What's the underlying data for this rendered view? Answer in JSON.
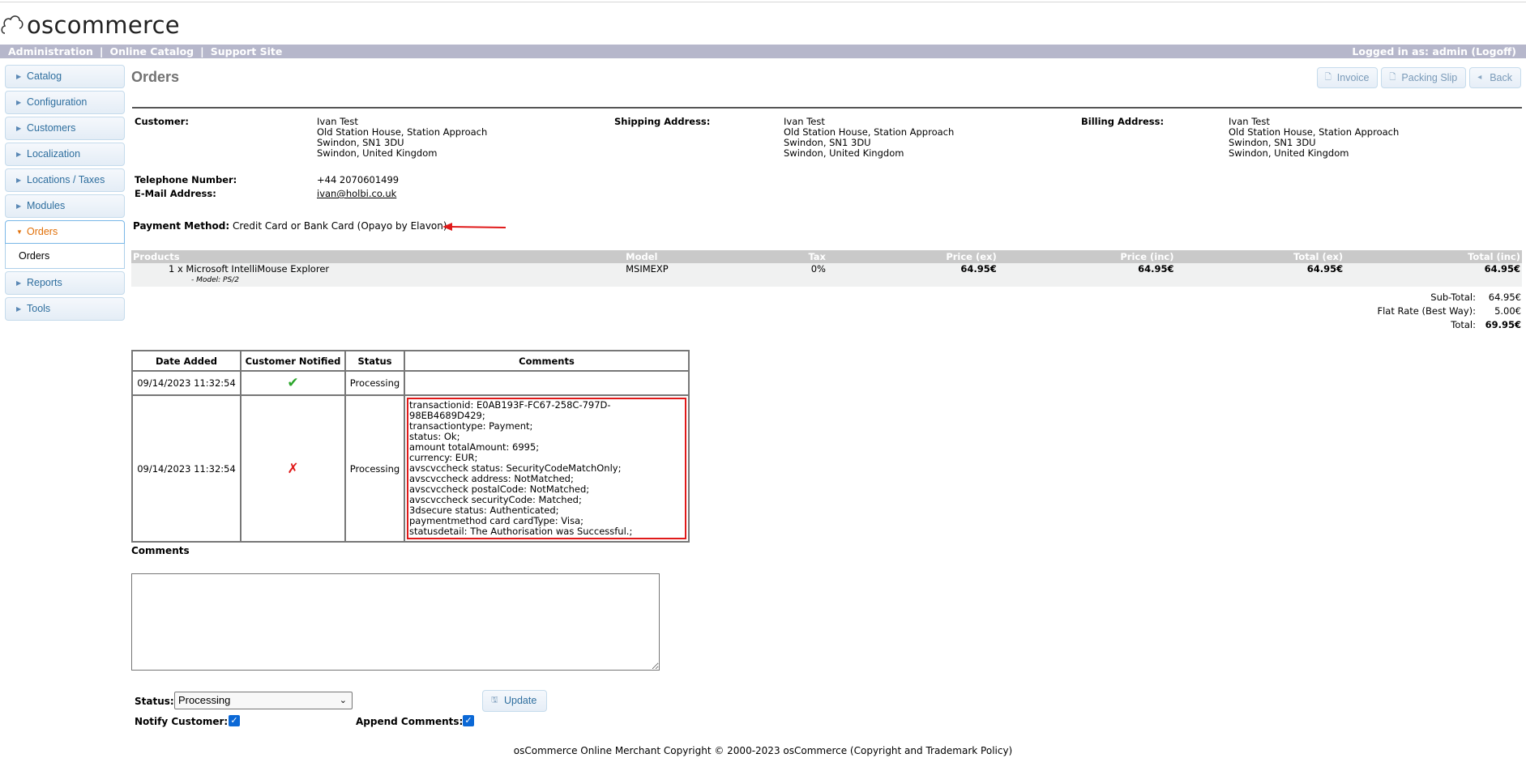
{
  "logo": {
    "text": "oscommerce"
  },
  "navbar": {
    "links": [
      "Administration",
      "Online Catalog",
      "Support Site"
    ],
    "logged_in": "Logged in as: admin (Logoff)"
  },
  "sidebar": {
    "items": [
      {
        "label": "Catalog"
      },
      {
        "label": "Configuration"
      },
      {
        "label": "Customers"
      },
      {
        "label": "Localization"
      },
      {
        "label": "Locations / Taxes"
      },
      {
        "label": "Modules"
      },
      {
        "label": "Orders",
        "active": true
      },
      {
        "label": "Reports"
      },
      {
        "label": "Tools"
      }
    ],
    "submenu": [
      "Orders"
    ]
  },
  "page": {
    "title": "Orders",
    "buttons": {
      "invoice": "Invoice",
      "packing_slip": "Packing Slip",
      "back": "Back"
    }
  },
  "customer": {
    "label": "Customer:",
    "lines": [
      "Ivan Test",
      "Old Station House, Station Approach",
      "Swindon, SN1 3DU",
      "Swindon, United Kingdom"
    ],
    "phone_label": "Telephone Number:",
    "phone": "+44 2070601499",
    "email_label": "E-Mail Address:",
    "email": "ivan@holbi.co.uk"
  },
  "shipping": {
    "label": "Shipping Address:",
    "lines": [
      "Ivan Test",
      "Old Station House, Station Approach",
      "Swindon, SN1 3DU",
      "Swindon, United Kingdom"
    ]
  },
  "billing": {
    "label": "Billing Address:",
    "lines": [
      "Ivan Test",
      "Old Station House, Station Approach",
      "Swindon, SN1 3DU",
      "Swindon, United Kingdom"
    ]
  },
  "payment": {
    "label": "Payment Method:",
    "value": "Credit Card or Bank Card (Opayo by Elavon)"
  },
  "products": {
    "headers": [
      "Products",
      "Model",
      "Tax",
      "Price (ex)",
      "Price (inc)",
      "Total (ex)",
      "Total (inc)"
    ],
    "rows": [
      {
        "name": "1 x Microsoft IntelliMouse Explorer",
        "attr": "- Model: PS/2",
        "model": "MSIMEXP",
        "tax": "0%",
        "price_ex": "64.95€",
        "price_inc": "64.95€",
        "total_ex": "64.95€",
        "total_inc": "64.95€"
      }
    ]
  },
  "totals": [
    {
      "label": "Sub-Total:",
      "value": "64.95€"
    },
    {
      "label": "Flat Rate (Best Way):",
      "value": "5.00€"
    },
    {
      "label": "Total:",
      "value": "69.95€"
    }
  ],
  "history": {
    "headers": [
      "Date Added",
      "Customer Notified",
      "Status",
      "Comments"
    ],
    "rows": [
      {
        "date": "09/14/2023 11:32:54",
        "notified": "✔",
        "status": "Processing",
        "comments": []
      },
      {
        "date": "09/14/2023 11:32:54",
        "notified": "✗",
        "status": "Processing",
        "comments": [
          "transactionid: E0AB193F-FC67-258C-797D-98EB4689D429;",
          "transactiontype: Payment;",
          "status: Ok;",
          "amount totalAmount: 6995;",
          "currency: EUR;",
          "avscvccheck status: SecurityCodeMatchOnly;",
          "avscvccheck address: NotMatched;",
          "avscvccheck postalCode: NotMatched;",
          "avscvccheck securityCode: Matched;",
          "3dsecure status: Authenticated;",
          "paymentmethod card cardType: Visa;",
          "statusdetail: The Authorisation was Successful.;"
        ]
      }
    ]
  },
  "form": {
    "comments_label": "Comments",
    "status_label": "Status:",
    "status_value": "Processing",
    "update_label": "Update",
    "notify_label": "Notify Customer:",
    "append_label": "Append Comments:"
  },
  "footer": "osCommerce Online Merchant Copyright © 2000-2023 osCommerce (Copyright and Trademark Policy)",
  "colors": {
    "nav_bg": "#b6b7cb",
    "link": "#2e6e9e",
    "active": "#e17009",
    "highlight": "#e01a1a"
  }
}
